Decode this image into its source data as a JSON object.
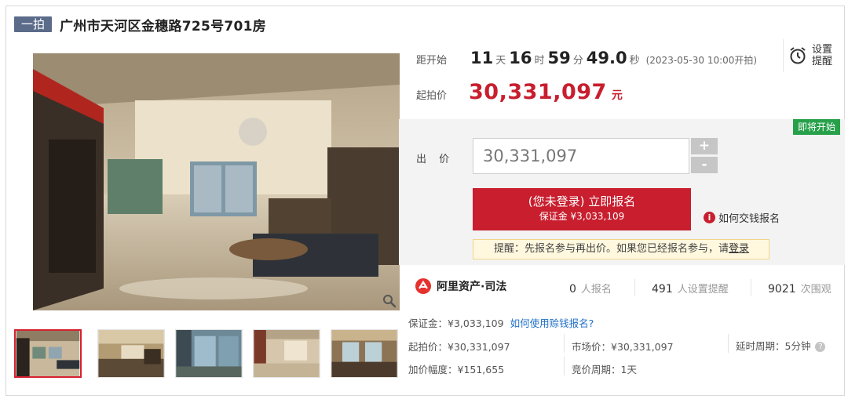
{
  "header": {
    "tag": "一拍",
    "title": "广州市天河区金穗路725号701房"
  },
  "countdown": {
    "label": "距开始",
    "days": "11",
    "days_unit": "天",
    "hours": "16",
    "hours_unit": "时",
    "minutes": "59",
    "minutes_unit": "分",
    "seconds": "49.0",
    "seconds_unit": "秒",
    "start_time": "(2023-05-30 10:00开拍)"
  },
  "reminder": {
    "line1": "设置",
    "line2": "提醒",
    "icon": "alarm-clock-icon"
  },
  "start_price": {
    "label": "起拍价",
    "value": "30,331,097",
    "unit": "元"
  },
  "bid": {
    "status": "即将开始",
    "label": "出 价",
    "value": "30,331,097",
    "plus": "+",
    "minus": "-",
    "signup_label": "(您未登录) 立即报名",
    "deposit_label": "保证金 ¥3,033,109",
    "how_pay": "如何交钱报名",
    "notice_prefix": "提醒：先报名参与再出价。如果您已经报名参与，请",
    "notice_link": "登录"
  },
  "stats": {
    "brand": "阿里资产·司法",
    "signups_num": "0",
    "signups_label": "人报名",
    "reminders_num": "491",
    "reminders_label": "人设置提醒",
    "views_num": "9021",
    "views_label": "次围观"
  },
  "details": {
    "deposit": "保证金：¥3,033,109",
    "deposit_help": "如何使用赊钱报名?",
    "start_price": "起拍价：¥30,331,097",
    "market_price": "市场价：¥30,331,097",
    "delay": "延时周期：5分钟",
    "increment": "加价幅度：¥151,655",
    "cycle": "竞价周期：1天"
  },
  "colors": {
    "accent_red": "#c81e2e",
    "status_green": "#27a04a",
    "tag_blue": "#5b6b8a",
    "link_blue": "#1e6fc7"
  }
}
